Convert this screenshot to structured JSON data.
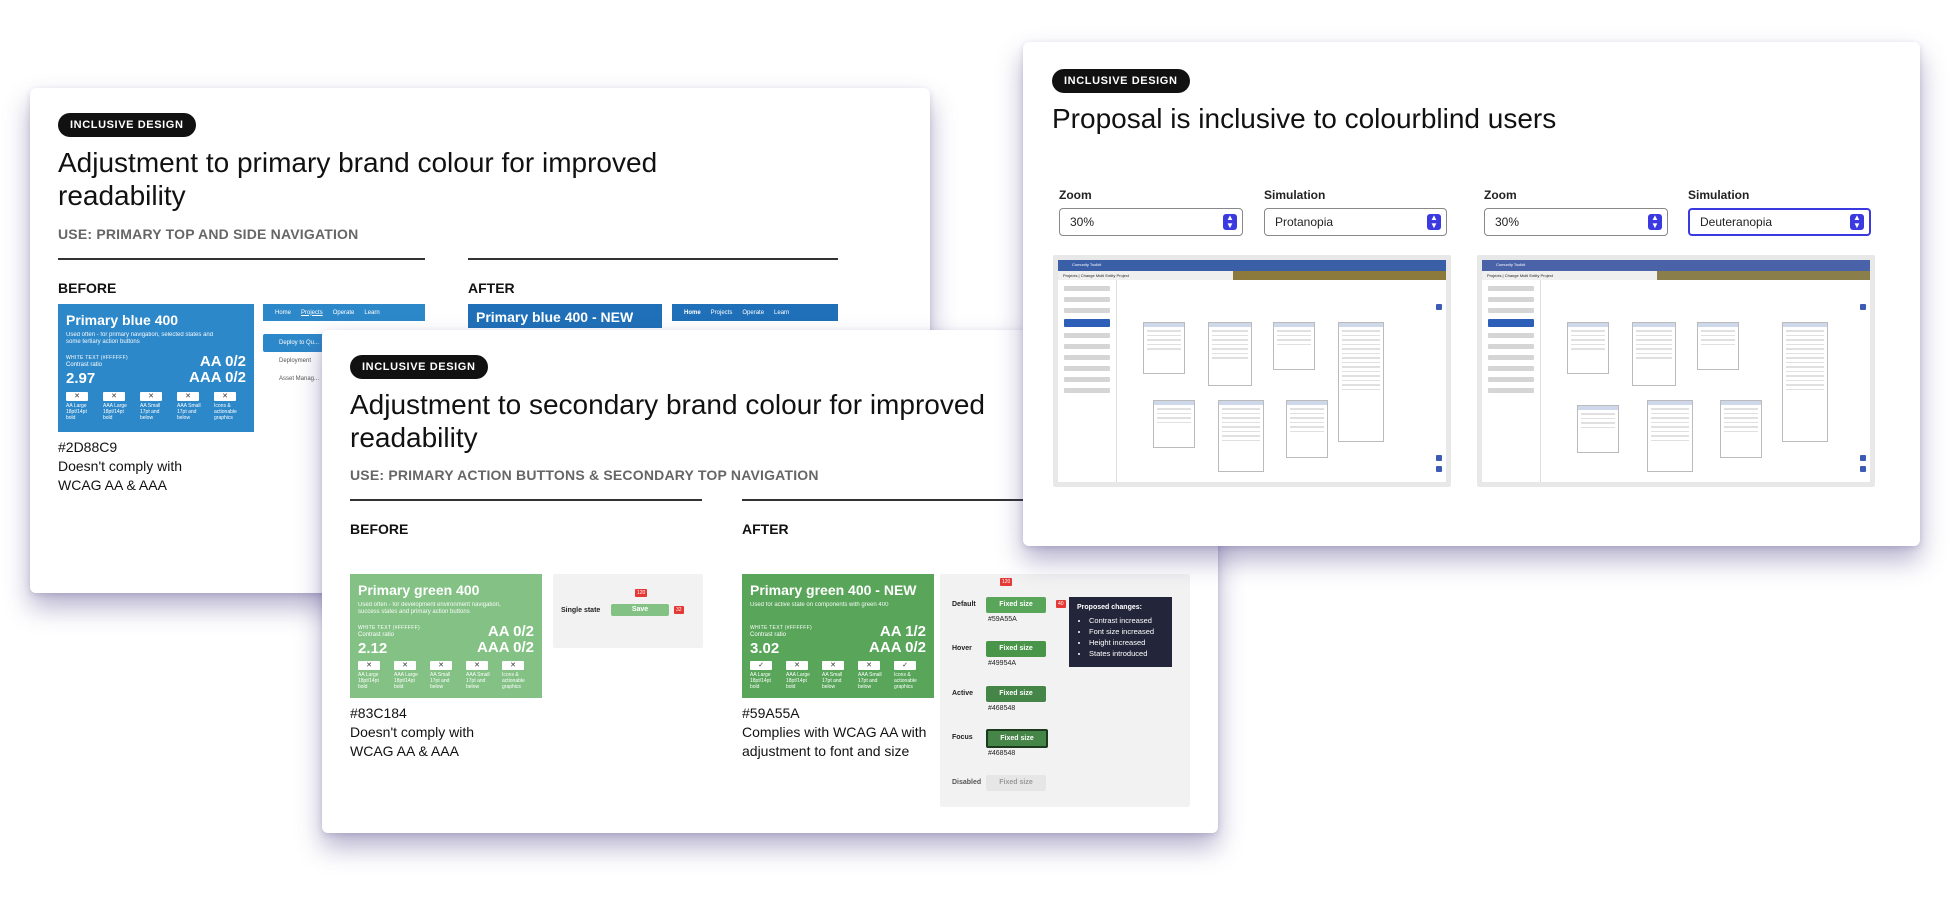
{
  "card1": {
    "badge": "INCLUSIVE DESIGN",
    "title": "Adjustment to primary brand colour for improved readability",
    "use": "USE: PRIMARY TOP AND SIDE NAVIGATION",
    "before_label": "BEFORE",
    "after_label": "AFTER",
    "before": {
      "swatch_name": "Primary blue 400",
      "swatch_desc": "Used often - for primary navigation, selected states and some tertiary action buttons",
      "white_text": "WHITE TEXT (#FFFFFF)",
      "contrast_label": "Contrast ratio",
      "ratio": "2.97",
      "aa": "AA 0/2",
      "aaa": "AAA 0/2",
      "checks": [
        {
          "mark": "✕",
          "label": "AA Large 18pt/14pt bold"
        },
        {
          "mark": "✕",
          "label": "AAA Large 18pt/14pt bold"
        },
        {
          "mark": "✕",
          "label": "AA Small 17pt and below"
        },
        {
          "mark": "✕",
          "label": "AAA Small 17pt and below"
        },
        {
          "mark": "✕",
          "label": "Icons & actionable graphics"
        }
      ],
      "hex": "#2D88C9",
      "desc": "Doesn't comply with WCAG AA & AAA",
      "color": "#2d88c9"
    },
    "after": {
      "swatch_name": "Primary blue 400 - NEW",
      "color": "#1f70b8"
    },
    "nav_items": [
      "Home",
      "Projects",
      "Operate",
      "Learn"
    ],
    "side_items": [
      "Deploy to Qu...",
      "Deployment",
      "Asset Manag..."
    ]
  },
  "card2": {
    "badge": "INCLUSIVE DESIGN",
    "title": "Adjustment to secondary brand colour for improved readability",
    "use": "USE: PRIMARY ACTION BUTTONS & SECONDARY TOP NAVIGATION",
    "before_label": "BEFORE",
    "after_label": "AFTER",
    "before": {
      "swatch_name": "Primary green 400",
      "swatch_desc": "Used often - for development environment navigation, success states and primary action buttons",
      "white_text": "WHITE TEXT (#FFFFFF)",
      "contrast_label": "Contrast ratio",
      "ratio": "2.12",
      "aa": "AA 0/2",
      "aaa": "AAA 0/2",
      "checks": [
        {
          "mark": "✕",
          "label": "AA Large 18pt/14pt bold"
        },
        {
          "mark": "✕",
          "label": "AAA Large 18pt/14pt bold"
        },
        {
          "mark": "✕",
          "label": "AA Small 17pt and below"
        },
        {
          "mark": "✕",
          "label": "AAA Small 17pt and below"
        },
        {
          "mark": "✕",
          "label": "Icons & actionable graphics"
        }
      ],
      "hex": "#83C184",
      "desc": "Doesn't comply with WCAG AA & AAA",
      "color": "#83c184",
      "state_label": "Single state",
      "button_label": "Save",
      "tag_w": "120",
      "tag_h": "32"
    },
    "after": {
      "swatch_name": "Primary green 400 - NEW",
      "swatch_desc": "Used for active state on components with green 400",
      "white_text": "WHITE TEXT (#FFFFFF)",
      "contrast_label": "Contrast ratio",
      "ratio": "3.02",
      "aa": "AA 1/2",
      "aaa": "AAA 0/2",
      "checks": [
        {
          "mark": "✓",
          "label": "AA Large 18pt/14pt bold"
        },
        {
          "mark": "✕",
          "label": "AAA Large 18pt/14pt bold"
        },
        {
          "mark": "✕",
          "label": "AA Small 17pt and below"
        },
        {
          "mark": "✕",
          "label": "AAA Small 17pt and below"
        },
        {
          "mark": "✓",
          "label": "Icons & actionable graphics"
        }
      ],
      "hex": "#59A55A",
      "desc": "Complies with WCAG AA with adjustment to font and size",
      "color": "#59a55a",
      "tag_w": "120",
      "tag_h": "40",
      "states": [
        {
          "label": "Default",
          "button": "Fixed size",
          "hex": "#59A55A",
          "color": "#59a55a"
        },
        {
          "label": "Hover",
          "button": "Fixed size",
          "hex": "#49954A",
          "color": "#49954a"
        },
        {
          "label": "Active",
          "button": "Fixed size",
          "hex": "#468548",
          "color": "#468548"
        },
        {
          "label": "Focus",
          "button": "Fixed size",
          "hex": "#468548",
          "color": "#468548"
        },
        {
          "label": "Disabled",
          "button": "Fixed size",
          "hex": "",
          "color": "#e6e6e6"
        }
      ],
      "changes_title": "Proposed changes:",
      "changes": [
        "Contrast increased",
        "Font size increased",
        "Height increased",
        "States introduced"
      ]
    }
  },
  "card3": {
    "badge": "INCLUSIVE DESIGN",
    "title": "Proposal is inclusive to colourblind users",
    "zoom_label": "Zoom",
    "simulation_label": "Simulation",
    "left": {
      "zoom": "30%",
      "simulation": "Protanopia"
    },
    "right": {
      "zoom": "30%",
      "simulation": "Deuteranopia"
    },
    "app_name": "Comunity Toolkit",
    "project_title": "Projects | Change Multi Entity Project"
  }
}
